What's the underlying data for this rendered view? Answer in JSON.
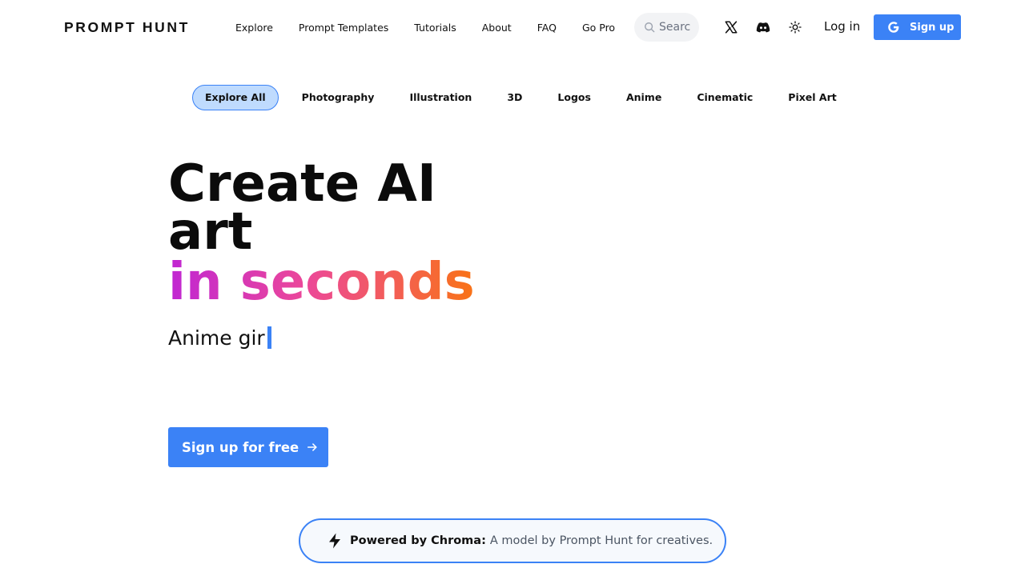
{
  "header": {
    "logo_text": "PROMPT HUNT",
    "nav": [
      {
        "label": "Explore"
      },
      {
        "label": "Prompt Templates"
      },
      {
        "label": "Tutorials"
      },
      {
        "label": "About"
      },
      {
        "label": "FAQ"
      },
      {
        "label": "Go Pro"
      }
    ],
    "search": {
      "placeholder": "Search",
      "value": ""
    },
    "icons": [
      "x-twitter-icon",
      "discord-icon",
      "sun-icon"
    ],
    "login_label": "Log in",
    "signup_label": "Sign up"
  },
  "categories": {
    "active": "Explore All",
    "items": [
      {
        "label": "Explore All"
      },
      {
        "label": "Photography"
      },
      {
        "label": "Illustration"
      },
      {
        "label": "3D"
      },
      {
        "label": "Logos"
      },
      {
        "label": "Anime"
      },
      {
        "label": "Cinematic"
      },
      {
        "label": "Pixel Art"
      }
    ]
  },
  "hero": {
    "title": "Create AI art",
    "accent": "in seconds",
    "typing_text": "Anime gir",
    "cta_label": "Sign up for free"
  },
  "powered": {
    "label": "Powered by Chroma:",
    "description": "A model by Prompt Hunt for creatives."
  },
  "colors": {
    "brand_blue": "#3b82f6",
    "active_chip_bg": "#bfdbfe",
    "gradient": [
      "#c026d3",
      "#ec4899",
      "#f97316"
    ]
  }
}
